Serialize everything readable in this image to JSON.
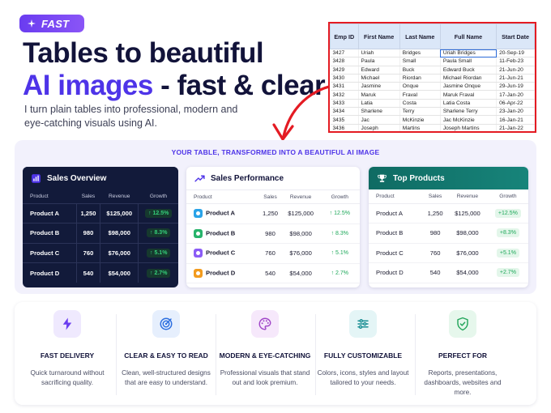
{
  "badge": {
    "label": "FAST",
    "icon": "sparkle-icon"
  },
  "hero": {
    "title_line1": "Tables to beautiful",
    "title_highlight": "AI images",
    "title_rest": " - fast & clear",
    "subtitle": "I turn plain tables into professional, modern and eye-catching visuals using AI."
  },
  "sheet": {
    "headers": [
      "Emp ID",
      "First Name",
      "Last Name",
      "Full Name",
      "Start Date"
    ],
    "rows": [
      [
        "3427",
        "Uriah",
        "Bridges",
        "Uriah Bridges",
        "20-Sep-19"
      ],
      [
        "3428",
        "Paula",
        "Small",
        "Paula Small",
        "11-Feb-23"
      ],
      [
        "3429",
        "Edward",
        "Buck",
        "Edward Buck",
        "21-Jun-20"
      ],
      [
        "3430",
        "Michael",
        "Riordan",
        "Michael Riordan",
        "21-Jun-21"
      ],
      [
        "3431",
        "Jasmine",
        "Onque",
        "Jasmine Onque",
        "29-Jun-19"
      ],
      [
        "3432",
        "Maruk",
        "Fraval",
        "Maruk Fraval",
        "17-Jan-20"
      ],
      [
        "3433",
        "Latia",
        "Costa",
        "Latia Costa",
        "06-Apr-22"
      ],
      [
        "3434",
        "Sharlene",
        "Terry",
        "Sharlene Terry",
        "23-Jan-20"
      ],
      [
        "3435",
        "Jac",
        "McKinzie",
        "Jac McKinzie",
        "16-Jan-21"
      ],
      [
        "3436",
        "Joseph",
        "Martins",
        "Joseph Martins",
        "21-Jan-22"
      ]
    ],
    "border_color": "#e41b23"
  },
  "band": {
    "title": "YOUR TABLE, TRANSFORMED INTO A BEAUTIFUL AI IMAGE"
  },
  "cards": {
    "overview": {
      "title": "Sales Overview",
      "icon": "bar-chart-icon",
      "headers": [
        "Product",
        "Sales",
        "Revenue",
        "Growth"
      ],
      "rows": [
        [
          "Product A",
          "1,250",
          "$125,000",
          "↑ 12.5%"
        ],
        [
          "Product B",
          "980",
          "$98,000",
          "↑ 8.3%"
        ],
        [
          "Product C",
          "760",
          "$76,000",
          "↑ 5.1%"
        ],
        [
          "Product D",
          "540",
          "$54,000",
          "↑ 2.7%"
        ]
      ]
    },
    "performance": {
      "title": "Sales Performance",
      "icon": "trend-line-icon",
      "headers": [
        "Product",
        "Sales",
        "Revenue",
        "Growth"
      ],
      "rows": [
        [
          "Product A",
          "1,250",
          "$125,000",
          "↑ 12.5%"
        ],
        [
          "Product B",
          "980",
          "$98,000",
          "↑ 8.3%"
        ],
        [
          "Product C",
          "760",
          "$76,000",
          "↑ 5.1%"
        ],
        [
          "Product D",
          "540",
          "$54,000",
          "↑ 2.7%"
        ]
      ],
      "dot_colors": [
        "#2aa3e8",
        "#27b36b",
        "#8b5cf6",
        "#f29b1e"
      ]
    },
    "top": {
      "title": "Top Products",
      "icon": "trophy-icon",
      "headers": [
        "Product",
        "Sales",
        "Revenue",
        "Growth"
      ],
      "rows": [
        [
          "Product A",
          "1,250",
          "$125,000",
          "+12.5%"
        ],
        [
          "Product B",
          "980",
          "$98,000",
          "+8.3%"
        ],
        [
          "Product C",
          "760",
          "$76,000",
          "+5.1%"
        ],
        [
          "Product D",
          "540",
          "$54,000",
          "+2.7%"
        ]
      ]
    }
  },
  "features": [
    {
      "title": "FAST DELIVERY",
      "desc": "Quick turnaround without sacrificing quality.",
      "icon": "lightning-icon",
      "bg": "#efe9fe",
      "color": "#6a3cf0"
    },
    {
      "title": "CLEAR & EASY TO READ",
      "desc": "Clean, well-structured designs that are easy to understand.",
      "icon": "target-icon",
      "bg": "#e6effd",
      "color": "#2d6fe0"
    },
    {
      "title": "MODERN & EYE-CATCHING",
      "desc": "Professional visuals that stand out and look premium.",
      "icon": "palette-icon",
      "bg": "#f6e8fb",
      "color": "#a046c8"
    },
    {
      "title": "FULLY CUSTOMIZABLE",
      "desc": "Colors, icons, styles and layout tailored to your needs.",
      "icon": "sliders-icon",
      "bg": "#e4f5f6",
      "color": "#1b8f94"
    },
    {
      "title": "PERFECT FOR",
      "desc": "Reports, presentations, dashboards, websites and more.",
      "icon": "shield-check-icon",
      "bg": "#e6f7ec",
      "color": "#22a55a"
    }
  ]
}
